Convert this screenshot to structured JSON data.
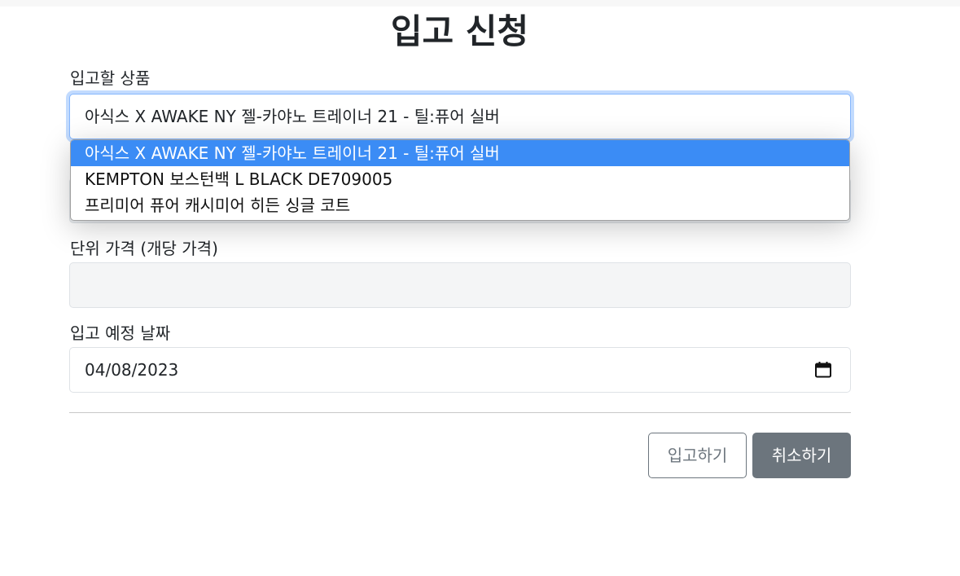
{
  "page": {
    "title": "입고 신청"
  },
  "form": {
    "product": {
      "label": "입고할 상품",
      "value": "아식스 X AWAKE NY 젤-카야노 트레이너 21 - 틸:퓨어 실버",
      "options": [
        "아식스 X AWAKE NY 젤-카야노 트레이너 21 - 틸:퓨어 실버",
        "KEMPTON 보스턴백 L BLACK DE709005",
        "프리미어 퓨어 캐시미어 히든 싱글 코트"
      ],
      "selected_index": 0
    },
    "unit_price": {
      "label": "단위 가격 (개당 가격)",
      "value": ""
    },
    "date": {
      "label": "입고 예정 날짜",
      "value": "04/08/2023",
      "icon": "calendar-icon"
    }
  },
  "actions": {
    "submit_label": "입고하기",
    "cancel_label": "취소하기"
  },
  "colors": {
    "focus_border": "#86b7fe",
    "selected_option": "#3b8cf5",
    "secondary": "#6c757d"
  }
}
